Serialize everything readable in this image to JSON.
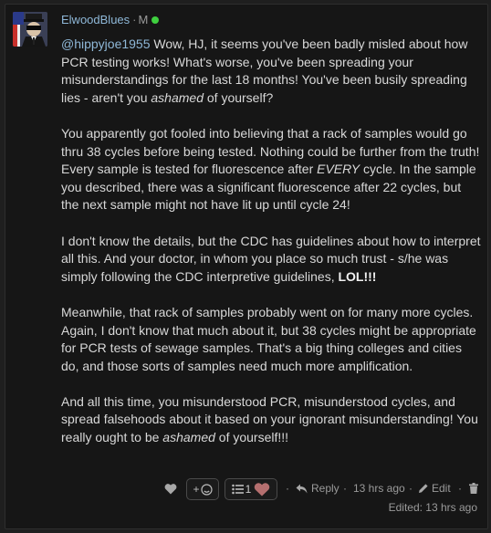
{
  "post": {
    "author": "ElwoodBlues",
    "separator": "·",
    "rank_badge": "M",
    "online_color": "#3fcf3f",
    "link_color": "#8fb8d8",
    "paragraphs": {
      "p1": {
        "mention": "@hippyjoe1955",
        "before_em": " Wow, HJ, it seems you've been badly misled about how PCR testing works! What's worse, you've been spreading your misunderstandings for the last 18 months! You've been busily spreading lies - aren't you ",
        "em": "ashamed",
        "after_em": " of yourself?"
      },
      "p2": {
        "before_em": "You apparently got fooled into believing that a rack of samples would go thru 38 cycles before being tested. Nothing could be further from the truth! Every sample is tested for fluorescence after ",
        "em": "EVERY",
        "after_em": " cycle. In the sample you described, there was a significant fluorescence after 22 cycles, but the next sample might not have lit up until cycle 24!"
      },
      "p3": {
        "text": "I don't know the details, but the CDC has guidelines about how to interpret all this. And your doctor, in whom you place so much trust - s/he was simply following the CDC interpretive guidelines, ",
        "strong": "LOL!!!"
      },
      "p4": {
        "text": "Meanwhile, that rack of samples probably went on for many more cycles. Again, I don't know that much about it, but 38 cycles might be appropriate for PCR tests of sewage samples. That's a big thing colleges and cities do, and those sorts of samples need much more amplification."
      },
      "p5": {
        "before_em": "And all this time, you misunderstood PCR, misunderstood cycles, and spread falsehoods about it based on your ignorant misunderstanding! You really ought to be ",
        "em": "ashamed",
        "after_em": " of yourself!!!"
      }
    },
    "actions": {
      "add_reaction_label": "+",
      "reaction_count": "1",
      "reply_label": "Reply",
      "dot": "·",
      "timestamp": "13 hrs ago",
      "edit_label": "Edit"
    },
    "edited_label": "Edited: 13 hrs ago"
  }
}
